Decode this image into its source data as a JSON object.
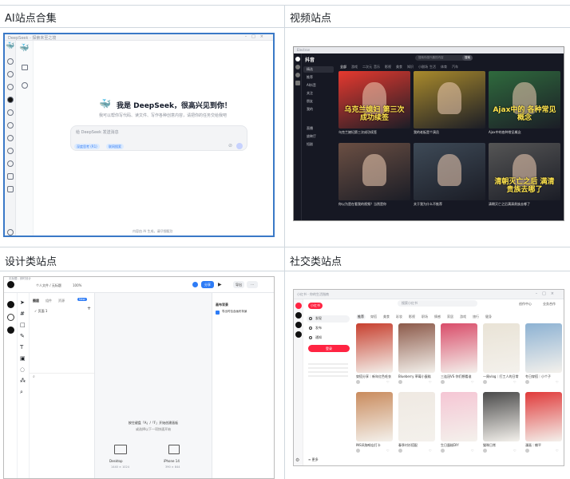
{
  "sections": [
    {
      "title": "AI站点合集"
    },
    {
      "title": "视频站点"
    },
    {
      "title": "设计类站点"
    },
    {
      "title": "社交类站点"
    }
  ],
  "deepseek": {
    "window_title": "DeepSeek - 探索未至之境",
    "greeting": "我是 DeepSeek，很高兴见到你！",
    "subtitle": "我可以帮你写代码、读文件、写作各种创意内容，请把你的任务交给我吧~",
    "placeholder": "给 DeepSeek 发送消息",
    "chip_deep": "深度思考 (R1)",
    "chip_search": "联网搜索",
    "footer": "内容由 AI 生成，请仔细甄别",
    "whale_icon": "whale-logo-icon"
  },
  "douyin": {
    "logo": "抖音",
    "search_placeholder": "搜索你感兴趣的内容",
    "search_button": "搜索",
    "nav_tabs": [
      "全部",
      "游戏",
      "二次元",
      "音乐",
      "影视",
      "美食",
      "知识",
      "小剧场",
      "生活",
      "体育",
      "汽车"
    ],
    "side_items": [
      "精选",
      "推荐",
      "AI抖音",
      "关注",
      "朋友",
      "我的",
      "直播",
      "放映厅",
      "短剧"
    ],
    "video_cards": [
      {
        "overlay": "乌克兰媳妇 第三次成功续签",
        "caption": "乌克兰媳妇第三次成功续签",
        "accent": "#e6392f"
      },
      {
        "overlay": "",
        "caption": "我的老板是个演员",
        "accent": "#a98a2c"
      },
      {
        "overlay": "Ajax中的 各种常见 概念",
        "caption": "Ajax中的各种常见概念",
        "accent": "#2f6a3d"
      },
      {
        "overlay": "",
        "caption": "你以为是在看我的视频？当然是你",
        "accent": "#6b4f43"
      },
      {
        "overlay": "",
        "caption": "关于我为什么不推荐",
        "accent": "#3e4a57"
      },
      {
        "overlay": "清朝灭亡之后 满清贵族去哪了",
        "caption": "清朝灭亡之后满清贵族去哪了",
        "accent": "#555"
      }
    ]
  },
  "design": {
    "file_title": "无标题 - 即时设计",
    "zoom": "100%",
    "tabs": [
      "图层",
      "组件",
      "资源"
    ],
    "layer_page": "页面 1",
    "share_button": "分享",
    "export_button": "导出",
    "canvas_hint": "按住键盘「A」/「F」开始创建画板",
    "canvas_hint2": "或选择以下一项快速开始",
    "preset_desktop": "Desktop",
    "preset_mobile": "iPhone 14",
    "preset_desktop_size": "1440 × 1024",
    "preset_mobile_size": "390 × 844",
    "props_title": "画布背景",
    "props_item": "导出时包含画布背景",
    "ai_badge": "New"
  },
  "xiaohongshu": {
    "window_title": "小红书 - 你的生活指南",
    "logo": "小红书",
    "search_placeholder": "搜索小红书",
    "side_items": [
      "发现",
      "发布",
      "通知"
    ],
    "login_button": "登录",
    "top_links": [
      "创作中心",
      "业务合作"
    ],
    "categories": [
      "推荐",
      "穿搭",
      "美食",
      "彩妆",
      "影视",
      "职场",
      "情感",
      "家居",
      "游戏",
      "旅行",
      "健身"
    ],
    "more_label": "更多",
    "cards": [
      {
        "caption": "穿搭分享｜新年红色毛衣",
        "color": "#c7402f"
      },
      {
        "caption": "Blueberry 草莓小蛋糕",
        "color": "#8c5a4a"
      },
      {
        "caption": "三连冠VS 你们想看谁",
        "color": "#d94d6a"
      },
      {
        "caption": "一周vlog｜打工人的日常",
        "color": "#e9e3d6"
      },
      {
        "caption": "冬日穿搭｜小个子",
        "color": "#8db2d3"
      },
      {
        "caption": "INS风咖啡店打卡",
        "color": "#c98b5d"
      },
      {
        "caption": "春季衬衫搭配",
        "color": "#efe9e2"
      },
      {
        "caption": "生日蛋糕DIY",
        "color": "#f5c6d4"
      },
      {
        "caption": "猫咪日常",
        "color": "#4a4a4a"
      },
      {
        "caption": "漫画｜躺平",
        "color": "#e03a3a"
      }
    ]
  }
}
